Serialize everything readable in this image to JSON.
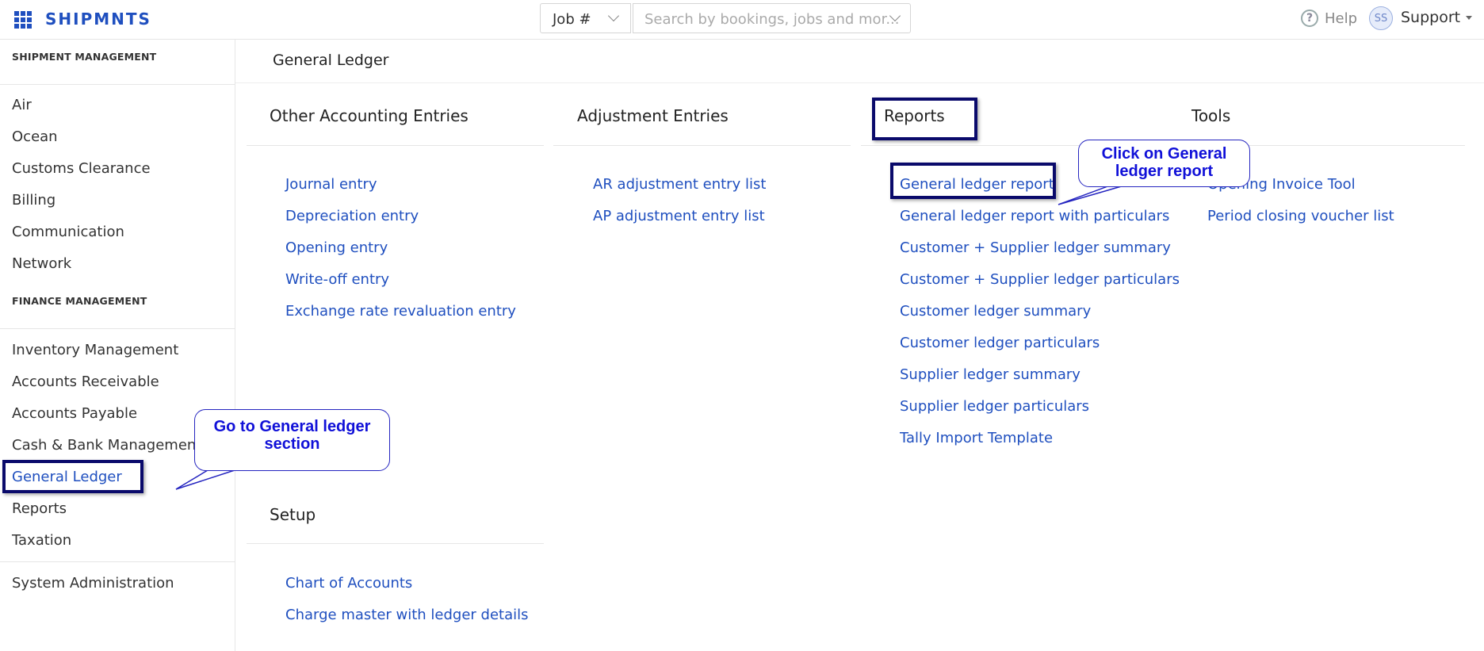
{
  "header": {
    "brand": "SHIPMNTS",
    "job_select": "Job #",
    "search_placeholder": "Search by bookings, jobs and mor...",
    "help_label": "Help",
    "avatar_initials": "SS",
    "user_menu": "Support"
  },
  "sidebar": {
    "shipment_heading": "SHIPMENT MANAGEMENT",
    "shipment_items": [
      "Air",
      "Ocean",
      "Customs Clearance",
      "Billing",
      "Communication",
      "Network"
    ],
    "finance_heading": "FINANCE MANAGEMENT",
    "finance_items": [
      "Inventory Management",
      "Accounts Receivable",
      "Accounts Payable",
      "Cash & Bank Management",
      "General Ledger",
      "Reports",
      "Taxation"
    ],
    "admin_item": "System Administration"
  },
  "main": {
    "page_title": "General Ledger",
    "sections": {
      "other": {
        "title": "Other Accounting Entries",
        "links": [
          "Journal entry",
          "Depreciation entry",
          "Opening entry",
          "Write-off entry",
          "Exchange rate revaluation entry"
        ]
      },
      "adjustment": {
        "title": "Adjustment Entries",
        "links": [
          "AR adjustment entry list",
          "AP adjustment entry list"
        ]
      },
      "reports": {
        "title": "Reports",
        "links": [
          "General ledger report",
          "General ledger report with particulars",
          "Customer + Supplier ledger summary",
          "Customer + Supplier ledger particulars",
          "Customer ledger summary",
          "Customer ledger particulars",
          "Supplier ledger summary",
          "Supplier ledger particulars",
          "Tally Import Template"
        ]
      },
      "tools": {
        "title": "Tools",
        "links": [
          "Opening Invoice Tool",
          "Period closing voucher list"
        ]
      },
      "setup": {
        "title": "Setup",
        "links": [
          "Chart of Accounts",
          "Charge master with ledger details"
        ]
      }
    }
  },
  "annotations": {
    "sidebar_callout": "Go to General ledger section",
    "report_callout": "Click on General ledger report"
  }
}
